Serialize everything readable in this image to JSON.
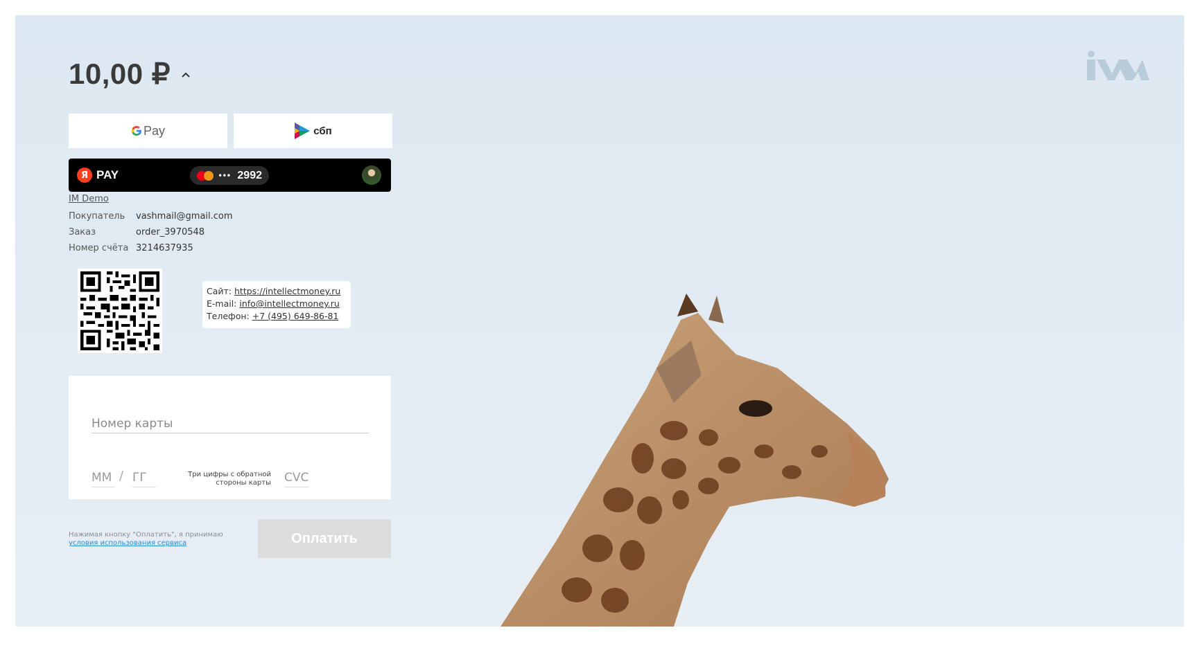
{
  "payment": {
    "amount": "10,00 ₽"
  },
  "quick_pay": {
    "gpay_label": "Pay",
    "sbp_label": "сбп"
  },
  "yandex_pay": {
    "ya_letter": "Я",
    "label": "PAY",
    "masked_dots": "•••",
    "card_last4": "2992"
  },
  "order": {
    "merchant": "IM Demo",
    "rows": [
      {
        "key": "Покупатель",
        "value": "vashmail@gmail.com"
      },
      {
        "key": "Заказ",
        "value": "order_3970548"
      },
      {
        "key": "Номер счёта",
        "value": "3214637935"
      }
    ]
  },
  "contacts": {
    "site_label": "Сайт:",
    "site_url": "https://intellectmoney.ru",
    "email_label": "E-mail:",
    "email": "info@intellectmoney.ru",
    "phone_label": "Телефон:",
    "phone": "+7 (495) 649-86-81"
  },
  "card_form": {
    "number_placeholder": "Номер карты",
    "mm_placeholder": "ММ",
    "separator": "/",
    "yy_placeholder": "ГГ",
    "cvc_hint": "Три цифры с обратной стороны карты",
    "cvc_placeholder": "CVC"
  },
  "footer": {
    "terms_text": "Нажимая кнопку \"Оплатить\", я принимаю",
    "terms_link": "условия использования сервиса",
    "pay_button": "Оплатить"
  },
  "colors": {
    "background": "#dfe9f2",
    "pay_button_disabled": "#dcdcdc",
    "link": "#2a8bd0",
    "yandex_red": "#fc3f1d"
  }
}
